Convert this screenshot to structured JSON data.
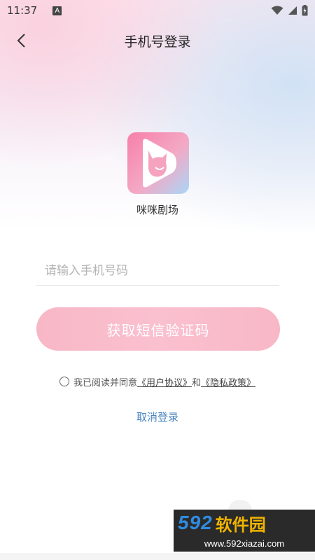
{
  "status_bar": {
    "time": "11:37",
    "notification_icon": "A"
  },
  "nav": {
    "title": "手机号登录",
    "back_icon": "chevron-left-icon"
  },
  "app": {
    "name": "咪咪剧场",
    "icon": "cat-play-logo",
    "icon_colors": [
      "#f77fa8",
      "#a9d6f7"
    ]
  },
  "login": {
    "phone_placeholder": "请输入手机号码",
    "phone_value": "",
    "sms_button_label": "获取短信验证码",
    "agree_prefix": "我已阅读并同意",
    "user_agreement": "《用户协议》",
    "and": "和",
    "privacy_policy": "《隐私政策》",
    "cancel_label": "取消登录"
  },
  "watermark": {
    "number": "592",
    "brand": "软件园",
    "url": "www.592xiazai.com"
  },
  "colors": {
    "accent_pink": "#f8b7c6",
    "link_blue": "#4a86c0"
  }
}
